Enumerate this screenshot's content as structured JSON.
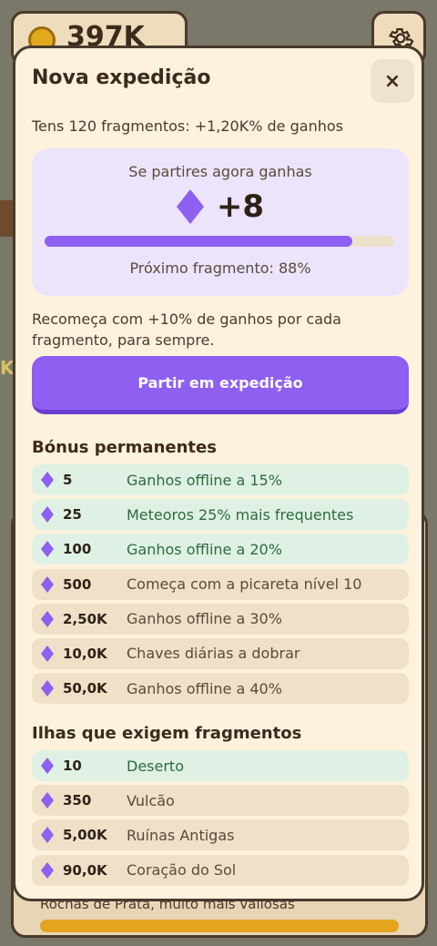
{
  "background": {
    "coins": "397K",
    "bottom_text": "Rochas de Prata, muito mais valiosas",
    "side_letter": "K"
  },
  "modal": {
    "title": "Nova expedição",
    "close_label": "×",
    "fragments_info": "Tens 120 fragmentos: +1,20K% de ganhos",
    "gain": {
      "label": "Se partires agora ganhas",
      "value": "+8",
      "progress_percent": 88,
      "next_fragment": "Próximo fragmento: 88%"
    },
    "restart_text": "Recomeça com +10% de ganhos por cada fragmento, para sempre.",
    "expedition_button": "Partir em expedição",
    "bonus_title": "Bónus permanentes",
    "bonuses": [
      {
        "cost": "5",
        "desc": "Ganhos offline a 15%",
        "unlocked": true
      },
      {
        "cost": "25",
        "desc": "Meteoros 25% mais frequentes",
        "unlocked": true
      },
      {
        "cost": "100",
        "desc": "Ganhos offline a 20%",
        "unlocked": true
      },
      {
        "cost": "500",
        "desc": "Começa com a picareta nível 10",
        "unlocked": false
      },
      {
        "cost": "2,50K",
        "desc": "Ganhos offline a 30%",
        "unlocked": false
      },
      {
        "cost": "10,0K",
        "desc": "Chaves diárias a dobrar",
        "unlocked": false
      },
      {
        "cost": "50,0K",
        "desc": "Ganhos offline a 40%",
        "unlocked": false
      }
    ],
    "islands_title": "Ilhas que exigem fragmentos",
    "islands": [
      {
        "cost": "10",
        "desc": "Deserto",
        "unlocked": true
      },
      {
        "cost": "350",
        "desc": "Vulcão",
        "unlocked": false
      },
      {
        "cost": "5,00K",
        "desc": "Ruínas Antigas",
        "unlocked": false
      },
      {
        "cost": "90,0K",
        "desc": "Coração do Sol",
        "unlocked": false
      }
    ]
  },
  "colors": {
    "accent": "#8e5ff0",
    "unlocked_bg": "#dff1e5",
    "locked_bg": "#efe0c7",
    "modal_bg": "#fff2dd"
  }
}
